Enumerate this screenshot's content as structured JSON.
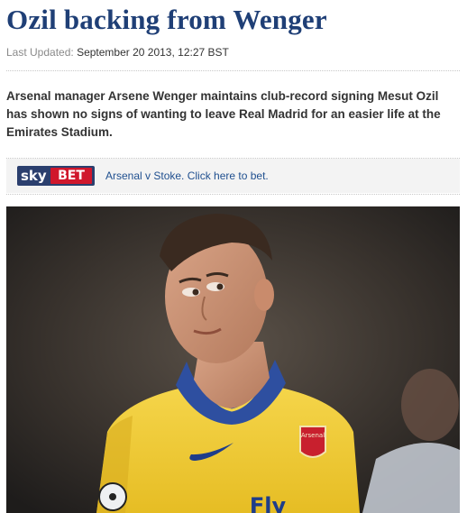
{
  "article": {
    "headline": "Ozil backing from Wenger",
    "updated_label": "Last Updated:",
    "updated_value": "September 20 2013, 12:27 BST",
    "intro": "Arsenal manager Arsene Wenger maintains club-record signing Mesut Ozil has shown no signs of wanting to leave Real Madrid for an easier life at the Emirates Stadium."
  },
  "promo": {
    "logo_sky": "sky",
    "logo_bet": "BET",
    "link_text": "Arsenal v Stoke. Click here to bet."
  },
  "photo": {
    "shirt_text": "Fly",
    "crest_text": "Arsenal"
  },
  "colors": {
    "headline": "#1f3f76",
    "link": "#1f4f8f",
    "skybet_navy": "#2b3f6e",
    "skybet_red": "#d0172c",
    "shirt_yellow": "#f3d13a",
    "collar_blue": "#2e4fa0"
  }
}
